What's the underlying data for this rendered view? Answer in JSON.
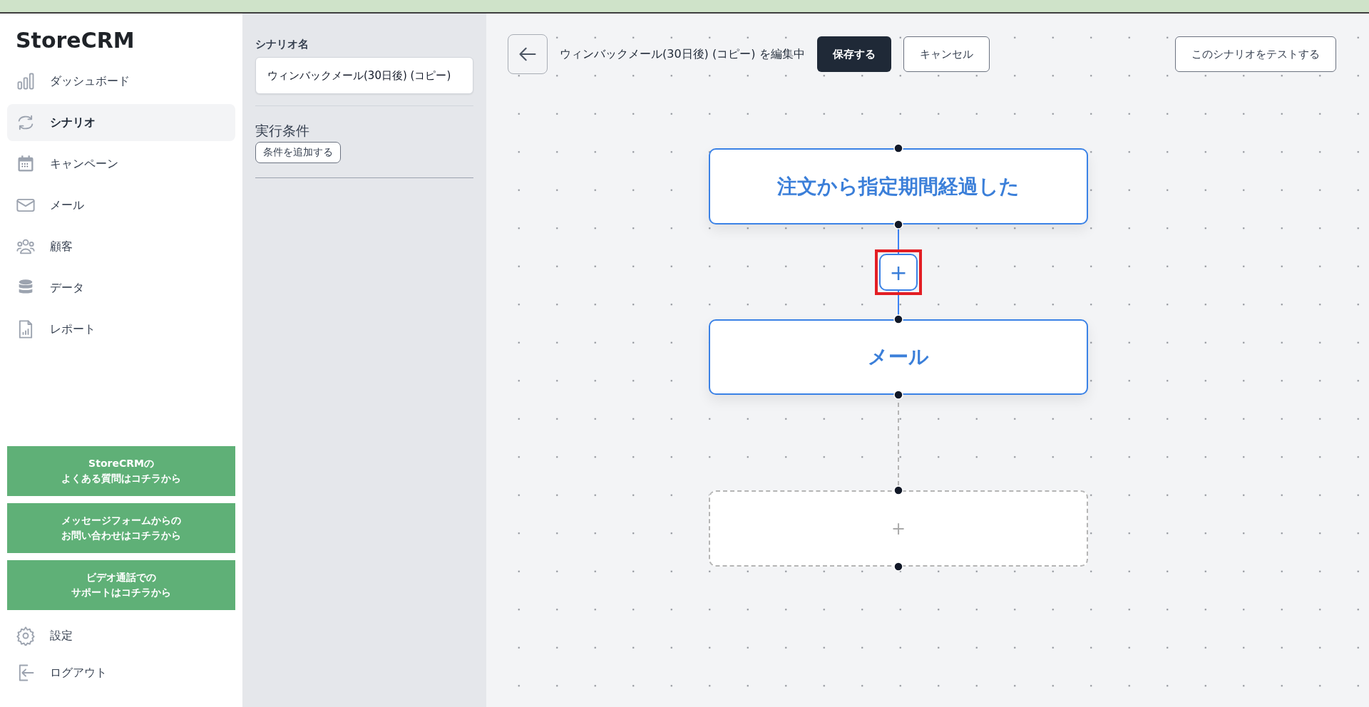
{
  "sidebar": {
    "logo": "StoreCRM",
    "items": [
      {
        "kind": "chart",
        "label": "ダッシュボード",
        "selected": false
      },
      {
        "kind": "cycle",
        "label": "シナリオ",
        "selected": true
      },
      {
        "kind": "calendar",
        "label": "キャンペーン",
        "selected": false
      },
      {
        "kind": "mail",
        "label": "メール",
        "selected": false
      },
      {
        "kind": "people",
        "label": "顧客",
        "selected": false
      },
      {
        "kind": "database",
        "label": "データ",
        "selected": false
      },
      {
        "kind": "report",
        "label": "レポート",
        "selected": false
      }
    ],
    "help_buttons": [
      [
        "StoreCRMの",
        "よくある質問はコチラから"
      ],
      [
        "メッセージフォームからの",
        "お問い合わせはコチラから"
      ],
      [
        "ビデオ通話での",
        "サポートはコチラから"
      ]
    ],
    "footer_items": [
      {
        "kind": "gear",
        "label": "設定"
      },
      {
        "kind": "logout",
        "label": "ログアウト"
      }
    ]
  },
  "settings_panel": {
    "name_label": "シナリオ名",
    "name_value": "ウィンバックメール(30日後) (コピー)",
    "conditions_label": "実行条件",
    "add_condition_button": "条件を追加する"
  },
  "toolbar": {
    "title": "ウィンバックメール(30日後) (コピー) を編集中",
    "save_button": "保存する",
    "cancel_button": "キャンセル",
    "test_button": "このシナリオをテストする"
  },
  "flow": {
    "nodes": [
      {
        "kind": "trigger",
        "label": "注文から指定期間経過した"
      },
      {
        "kind": "add",
        "label": "+",
        "highlighted": true
      },
      {
        "kind": "action",
        "label": "メール"
      },
      {
        "kind": "placeholder",
        "label": "+"
      }
    ]
  }
}
